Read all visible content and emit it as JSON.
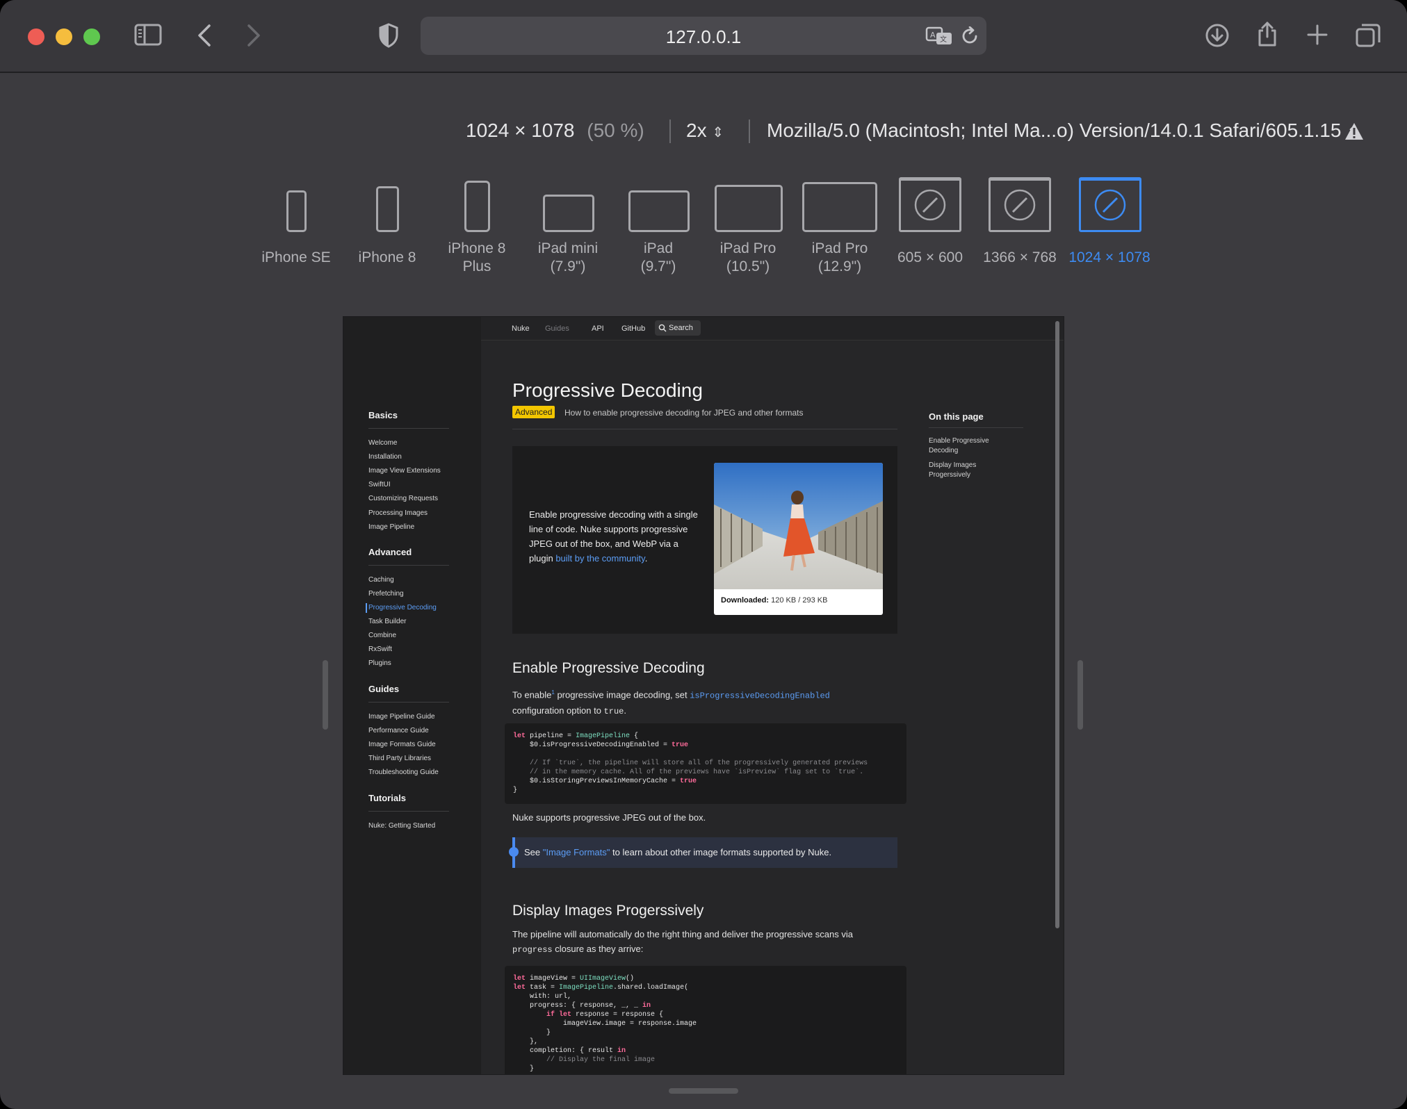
{
  "toolbar": {
    "url": "127.0.0.1",
    "icons": [
      "sidebar-icon",
      "back-icon",
      "forward-icon",
      "shield-icon",
      "translate-icon",
      "reload-icon",
      "download-icon",
      "share-icon",
      "new-tab-icon",
      "tabs-overview-icon"
    ]
  },
  "rdm": {
    "size": "1024 × 1078",
    "zoom": "(50 %)",
    "dpr": "2x",
    "user_agent": "Mozilla/5.0 (Macintosh; Intel Ma...o) Version/14.0.1 Safari/605.1.15",
    "devices": [
      {
        "line1": "iPhone SE",
        "line2": ""
      },
      {
        "line1": "iPhone 8",
        "line2": ""
      },
      {
        "line1": "iPhone 8",
        "line2": "Plus"
      },
      {
        "line1": "iPad mini",
        "line2": "(7.9\")"
      },
      {
        "line1": "iPad",
        "line2": "(9.7\")"
      },
      {
        "line1": "iPad Pro",
        "line2": "(10.5\")"
      },
      {
        "line1": "iPad Pro",
        "line2": "(12.9\")"
      },
      {
        "line1": "605 × 600",
        "line2": ""
      },
      {
        "line1": "1366 × 768",
        "line2": ""
      },
      {
        "line1": "1024 × 1078",
        "line2": ""
      }
    ],
    "active_device": "1024 × 1078",
    "accent_color": "#3d8bf2"
  },
  "site": {
    "nav": [
      "Nuke",
      "Guides",
      "API",
      "GitHub"
    ],
    "search_label": "Search",
    "sidebar": [
      {
        "heading": "Basics",
        "items": [
          "Welcome",
          "Installation",
          "Image View Extensions",
          "SwiftUI",
          "Customizing Requests",
          "Processing Images",
          "Image Pipeline"
        ]
      },
      {
        "heading": "Advanced",
        "items": [
          "Caching",
          "Prefetching",
          "Progressive Decoding",
          "Task Builder",
          "Combine",
          "RxSwift",
          "Plugins"
        ]
      },
      {
        "heading": "Guides",
        "items": [
          "Image Pipeline Guide",
          "Performance Guide",
          "Image Formats Guide",
          "Third Party Libraries",
          "Troubleshooting Guide"
        ]
      },
      {
        "heading": "Tutorials",
        "items": [
          "Nuke: Getting Started"
        ]
      }
    ],
    "active_item": "Progressive Decoding",
    "title": "Progressive Decoding",
    "badge": "Advanced",
    "subtitle": "How to enable progressive decoding for JPEG and other formats",
    "hero": {
      "text": "Enable progressive decoding with a single line of code. Nuke supports progressive JPEG out of the box, and WebP via a plugin ",
      "link": "built by the community",
      "after": ".",
      "caption_label": "Downloaded:",
      "caption_value": "120 KB / 293 KB"
    },
    "toc_heading": "On this page",
    "toc": [
      "Enable Progressive Decoding",
      "Display Images Progerssively"
    ],
    "section1": {
      "heading": "Enable Progressive Decoding",
      "p1_before": "To enable",
      "p1_sup": "1",
      "p1_mid": " progressive image decoding, set ",
      "p1_code": "isProgressiveDecodingEnabled",
      "p1_after_line": "configuration option to ",
      "p1_after_code": "true",
      "p1_end": ".",
      "p2": "Nuke supports progressive JPEG out of the box.",
      "note_before": "See ",
      "note_link": "\"Image Formats\"",
      "note_after": " to learn about other image formats supported by Nuke."
    },
    "code1": [
      "let pipeline = ImagePipeline {",
      "    $0.isProgressiveDecodingEnabled = true",
      "",
      "    // If `true`, the pipeline will store all of the progressively generated previews",
      "    // in the memory cache. All of the previews have `isPreview` flag set to `true`.",
      "    $0.isStoringPreviewsInMemoryCache = true",
      "}"
    ],
    "section2": {
      "heading": "Display Images Progerssively",
      "p1": "The pipeline will automatically do the right thing and deliver the progressive scans via",
      "p1_code": "progress",
      "p1_end": " closure as they arrive:"
    },
    "code2": [
      "let imageView = UIImageView()",
      "let task = ImagePipeline.shared.loadImage(",
      "    with: url,",
      "    progress: { response, _, _ in",
      "        if let response = response {",
      "            imageView.image = response.image",
      "        }",
      "    },",
      "    completion: { result in",
      "        // Display the final image",
      "    }"
    ]
  }
}
